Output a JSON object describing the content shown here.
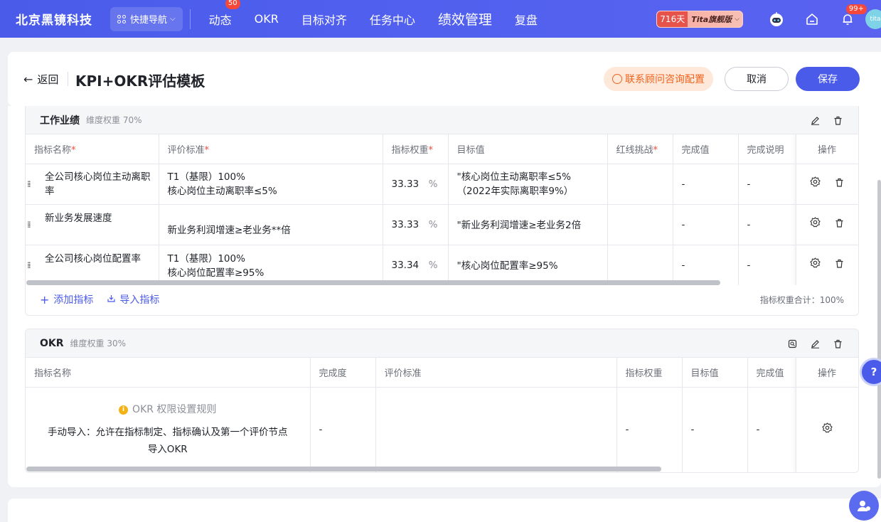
{
  "topnav": {
    "brand": "北京黑镜科技",
    "quick_nav": "快捷导航",
    "items": [
      {
        "label": "动态",
        "badge": "50"
      },
      {
        "label": "OKR"
      },
      {
        "label": "目标对齐"
      },
      {
        "label": "任务中心"
      },
      {
        "label": "绩效管理"
      },
      {
        "label": "复盘"
      }
    ],
    "days": "716天",
    "version": "Tita旗舰版",
    "notif_badge": "99+",
    "avatar_text": "tita"
  },
  "header": {
    "back": "返回",
    "title": "KPI+OKR评估模板",
    "consult": "联系顾问咨询配置",
    "cancel": "取消",
    "save": "保存"
  },
  "kpi": {
    "title": "工作业绩",
    "weight": "维度权重 70%",
    "columns": [
      "指标名称",
      "评价标准",
      "指标权重",
      "目标值",
      "红线挑战",
      "完成值",
      "完成说明",
      "操作"
    ],
    "required": "*",
    "rows": [
      {
        "name": "全公司核心岗位主动离职率",
        "criteria_1": "T1（基限）100%",
        "criteria_2": "核心岗位主动离职率≤5%",
        "weight": "33.33",
        "unit": "%",
        "target_1": "\"核心岗位主动离职率≤5%",
        "target_2": "（2022年实际离职率9%）",
        "redline": "",
        "done": "-",
        "note": "-"
      },
      {
        "name": "新业务发展速度",
        "criteria_1": "新业务利润增速≥老业务**倍",
        "criteria_2": "",
        "weight": "33.33",
        "unit": "%",
        "target_1": "\"新业务利润增速≥老业务2倍",
        "target_2": "",
        "redline": "",
        "done": "-",
        "note": "-"
      },
      {
        "name": "全公司核心岗位配置率",
        "criteria_1": "T1（基限）100%",
        "criteria_2": "核心岗位配置率≥95%",
        "weight": "33.34",
        "unit": "%",
        "target_1": "\"核心岗位配置率≥95%",
        "target_2": "",
        "redline": "",
        "done": "-",
        "note": "-"
      }
    ],
    "add": "添加指标",
    "import": "导入指标",
    "sum": "指标权重合计：100%"
  },
  "okr": {
    "title": "OKR",
    "weight": "维度权重 30%",
    "columns": [
      "指标名称",
      "完成度",
      "评价标准",
      "指标权重",
      "目标值",
      "完成值",
      "操作"
    ],
    "rule_title": "OKR 权限设置规则",
    "rule_desc_1": "手动导入：允许在指标制定、指标确认及第一个评价节点",
    "rule_desc_2": "导入OKR",
    "completion": "-",
    "weight_val": "-",
    "target": "-",
    "done": "-"
  },
  "help_label": "?"
}
